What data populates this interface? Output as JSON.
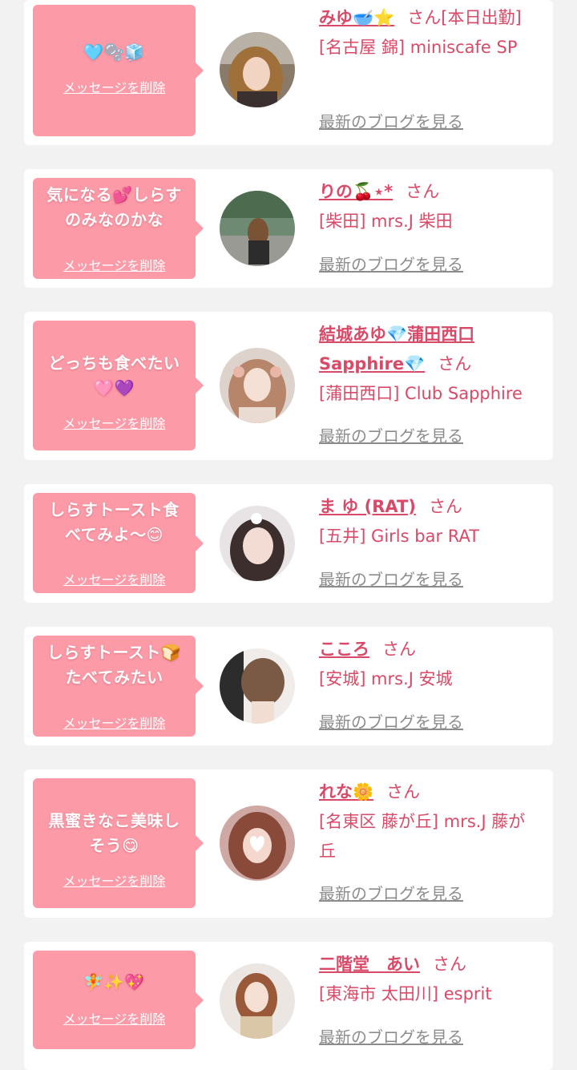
{
  "colors": {
    "accent": "#d94a68",
    "bubble": "#fd9aa8",
    "link_gray": "#8c8c8c",
    "background": "#f2f2f2"
  },
  "delete_label": "メッセージを削除",
  "blog_label": "最新のブログを見る",
  "san_suffix": "さん",
  "entries": [
    {
      "message": "🩵🫧🧊",
      "name": "みゆ🥣⭐",
      "shop_prefix": "[本日出勤]",
      "shop": "[名古屋 錦] miniscafe SP",
      "avatar_icon": "woman-portrait"
    },
    {
      "message": "気になる💕しらす\nのみなのかな",
      "name": "りの🍒⋆*",
      "shop_prefix": "",
      "shop": "[柴田] mrs.J 柴田",
      "avatar_icon": "woman-riverside"
    },
    {
      "message": "どっちも食べたい\n🩷💜",
      "name": "結城あゆ💎蒲田西口\nSapphire💎",
      "shop_prefix": "",
      "shop": "[蒲田西口] Club Sapphire",
      "avatar_icon": "woman-portrait"
    },
    {
      "message": "しらすトースト食\nべてみよ〜😊",
      "name": "ま ゆ (RAT)",
      "shop_prefix": "",
      "shop": "[五井] Girls bar RAT",
      "avatar_icon": "woman-portrait"
    },
    {
      "message": "しらすトースト🍞\nたべてみたい",
      "name": "こころ",
      "shop_prefix": "",
      "shop": "[安城] mrs.J 安城",
      "avatar_icon": "hair-back"
    },
    {
      "message": "黒蜜きなこ美味し\nそう😋",
      "name": "れな🌼",
      "shop_prefix": "",
      "shop": "[名東区 藤が丘] mrs.J 藤が丘",
      "avatar_icon": "woman-portrait"
    },
    {
      "message": "🧚✨💖",
      "name": "二階堂　あい",
      "shop_prefix": "",
      "shop": "[東海市 太田川] esprit",
      "avatar_icon": "woman-portrait"
    }
  ]
}
